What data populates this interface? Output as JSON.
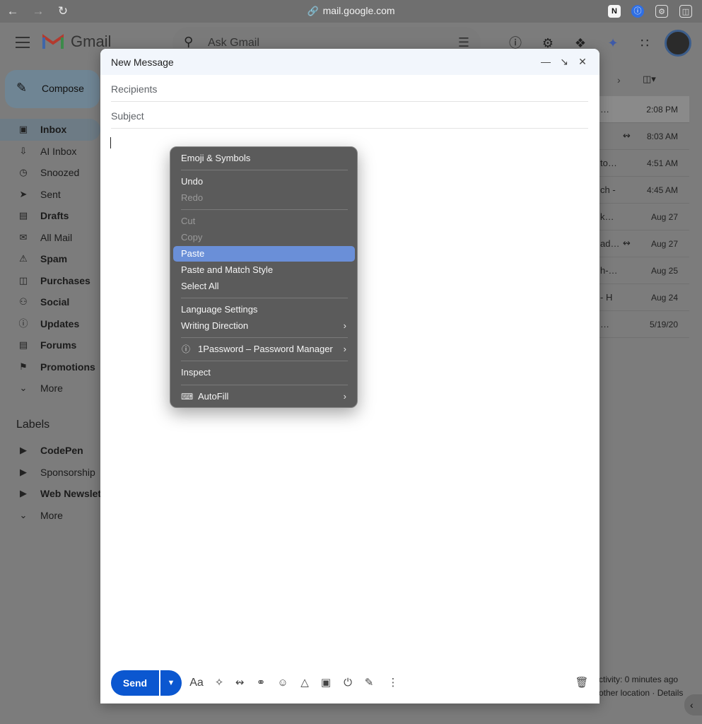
{
  "browser": {
    "url": "mail.google.com",
    "back_icon": "back-arrow-icon",
    "forward_icon": "forward-arrow-icon",
    "reload_icon": "reload-icon"
  },
  "gmail": {
    "logo_text": "Gmail",
    "search_placeholder": "Ask Gmail",
    "compose_label": "Compose",
    "nav": [
      {
        "label": "Inbox",
        "bold": true,
        "icon": "inbox-icon"
      },
      {
        "label": "AI Inbox",
        "bold": false,
        "icon": "ai-inbox-icon"
      },
      {
        "label": "Snoozed",
        "bold": false,
        "icon": "clock-icon"
      },
      {
        "label": "Sent",
        "bold": false,
        "icon": "send-icon"
      },
      {
        "label": "Drafts",
        "bold": true,
        "icon": "draft-icon"
      },
      {
        "label": "All Mail",
        "bold": false,
        "icon": "all-mail-icon"
      },
      {
        "label": "Spam",
        "bold": true,
        "icon": "spam-icon"
      },
      {
        "label": "Purchases",
        "bold": true,
        "icon": "bag-icon"
      },
      {
        "label": "Social",
        "bold": true,
        "icon": "people-icon"
      },
      {
        "label": "Updates",
        "bold": true,
        "icon": "info-icon"
      },
      {
        "label": "Forums",
        "bold": true,
        "icon": "forum-icon"
      },
      {
        "label": "Promotions",
        "bold": true,
        "icon": "tag-icon"
      },
      {
        "label": "More",
        "bold": false,
        "icon": "chevron-down-icon"
      }
    ],
    "labels_heading": "Labels",
    "labels": [
      {
        "label": "CodePen",
        "bold": true
      },
      {
        "label": "Sponsorship",
        "bold": false
      },
      {
        "label": "Web Newslet",
        "bold": true
      },
      {
        "label": "More",
        "bold": false
      }
    ],
    "rows": [
      {
        "snippet": "…",
        "date": "2:08 PM",
        "clip": false
      },
      {
        "snippet": "",
        "date": "8:03 AM",
        "clip": true
      },
      {
        "snippet": "to…",
        "date": "4:51 AM",
        "clip": false
      },
      {
        "snippet": "ch -",
        "date": "4:45 AM",
        "clip": false
      },
      {
        "snippet": "k…",
        "date": "Aug 27",
        "clip": false
      },
      {
        "snippet": "ad…",
        "date": "Aug 27",
        "clip": true
      },
      {
        "snippet": "h-…",
        "date": "Aug 25",
        "clip": false
      },
      {
        "snippet": "- H",
        "date": "Aug 24",
        "clip": false
      },
      {
        "snippet": "…",
        "date": "5/19/20",
        "clip": false
      }
    ],
    "footer_line1": "ctivity: 0 minutes ago",
    "footer_line2": "other location · Details"
  },
  "compose": {
    "title": "New Message",
    "recipients_placeholder": "Recipients",
    "subject_placeholder": "Subject",
    "send_label": "Send"
  },
  "context_menu": {
    "items": [
      {
        "label": "Emoji & Symbols",
        "disabled": false
      },
      {
        "label": "Undo",
        "disabled": false
      },
      {
        "label": "Redo",
        "disabled": true
      },
      {
        "label": "Cut",
        "disabled": true
      },
      {
        "label": "Copy",
        "disabled": true
      },
      {
        "label": "Paste",
        "disabled": false,
        "highlighted": true
      },
      {
        "label": "Paste and Match Style",
        "disabled": false
      },
      {
        "label": "Select All",
        "disabled": false
      },
      {
        "label": "Language Settings",
        "disabled": false
      },
      {
        "label": "Writing Direction",
        "disabled": false,
        "submenu": true
      },
      {
        "label": "1Password – Password Manager",
        "disabled": false,
        "submenu": true,
        "icon": "onepassword-icon"
      },
      {
        "label": "Inspect",
        "disabled": false
      },
      {
        "label": "AutoFill",
        "disabled": false,
        "submenu": true,
        "icon": "autofill-icon"
      }
    ]
  },
  "colors": {
    "send_blue": "#0b57d0",
    "menu_highlight": "#6a8fd8",
    "menu_bg": "#5b5b5b"
  }
}
